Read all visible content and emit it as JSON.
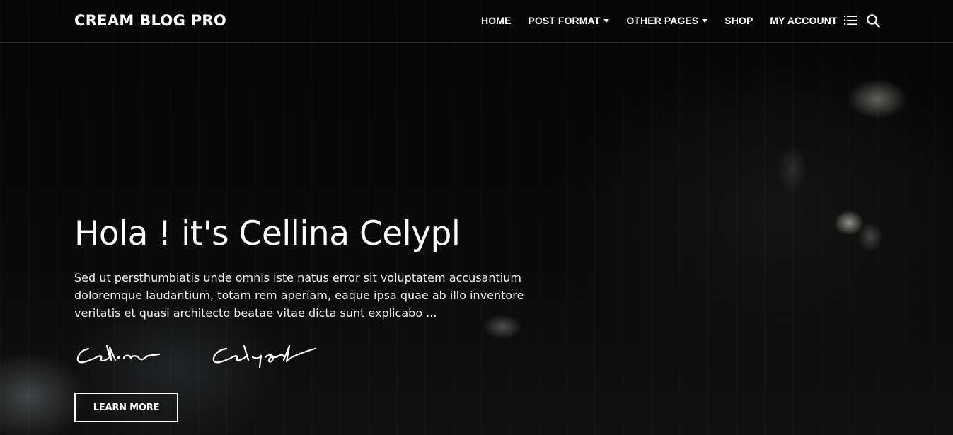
{
  "site": {
    "logo": "CREAM BLOG PRO"
  },
  "nav": {
    "items": [
      {
        "label": "HOME",
        "dropdown": false
      },
      {
        "label": "POST FORMAT",
        "dropdown": true
      },
      {
        "label": "OTHER PAGES",
        "dropdown": true
      },
      {
        "label": "SHOP",
        "dropdown": false
      },
      {
        "label": "MY ACCOUNT",
        "dropdown": false
      }
    ],
    "icons": [
      "list-icon",
      "search-icon"
    ]
  },
  "hero": {
    "title": "Hola ! it's Cellina Celypl",
    "text": "Sed ut persthumbiatis unde omnis iste natus error sit voluptatem accusantium doloremque laudantium, totam rem aperiam, eaque ipsa quae ab illo inventore veritatis et quasi architecto beatae vitae dicta sunt explicabo ...",
    "signature": "Cellina Celypl",
    "button_label": "LEARN MORE"
  },
  "colors": {
    "background": "#000000",
    "text": "#ffffff"
  }
}
